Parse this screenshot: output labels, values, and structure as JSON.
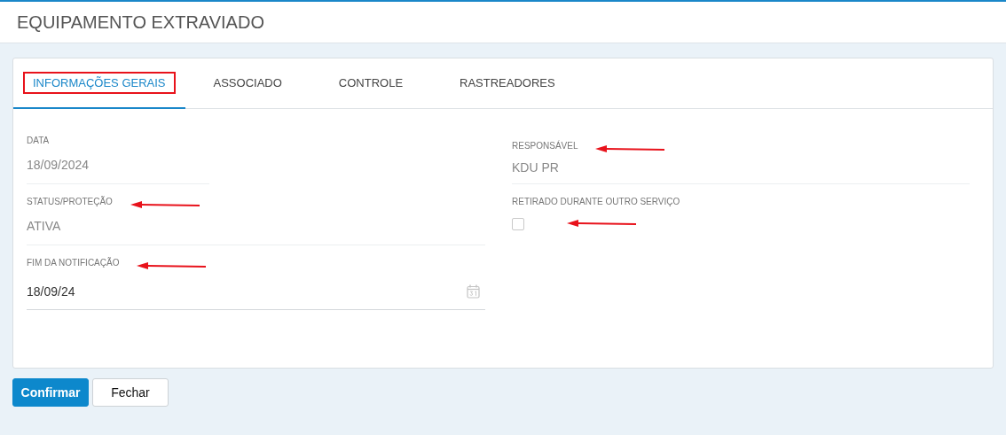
{
  "page": {
    "title": "EQUIPAMENTO EXTRAVIADO"
  },
  "tabs": [
    {
      "label": "INFORMAÇÕES GERAIS",
      "selected": true,
      "highlighted": true
    },
    {
      "label": "ASSOCIADO",
      "selected": false,
      "highlighted": false
    },
    {
      "label": "CONTROLE",
      "selected": false,
      "highlighted": false
    },
    {
      "label": "RASTREADORES",
      "selected": false,
      "highlighted": false
    }
  ],
  "left_fields": [
    {
      "kind": "short-text",
      "label": "DATA",
      "value": "18/09/2024",
      "arrow": false
    },
    {
      "kind": "text",
      "label": "STATUS/PROTEÇÃO",
      "value": "ATIVA",
      "arrow": true
    },
    {
      "kind": "date-input",
      "label": "FIM DA NOTIFICAÇÃO",
      "value": "18/09/24",
      "arrow": true
    }
  ],
  "right_fields": [
    {
      "kind": "text",
      "label": "RESPONSÁVEL",
      "value": "KDU PR",
      "arrow": true
    },
    {
      "kind": "checkbox",
      "label": "RETIRADO DURANTE OUTRO SERVIÇO",
      "checked": false,
      "arrow": true
    }
  ],
  "buttons": [
    {
      "kind": "primary",
      "label": "Confirmar"
    },
    {
      "kind": "secondary",
      "label": "Fechar"
    }
  ]
}
